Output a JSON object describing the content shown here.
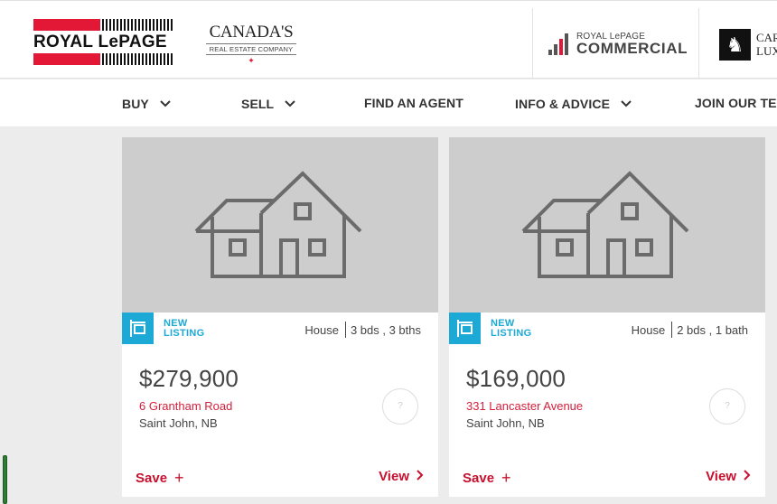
{
  "header": {
    "brand": "ROYAL LePAGE",
    "tagline_main": "CANADA'S",
    "tagline_sub": "REAL ESTATE COMPANY",
    "commercial_top": "ROYAL LePAGE",
    "commercial_main": "COMMERCIAL",
    "luxury_line1": "CAR",
    "luxury_line2": "LUX"
  },
  "nav": {
    "items": [
      {
        "label": "BUY",
        "has_dropdown": true
      },
      {
        "label": "SELL",
        "has_dropdown": true
      },
      {
        "label": "FIND AN AGENT",
        "has_dropdown": false
      },
      {
        "label": "INFO & ADVICE",
        "has_dropdown": true
      },
      {
        "label": "JOIN OUR TEAM",
        "has_dropdown": false
      }
    ]
  },
  "listings": [
    {
      "badge_line1": "NEW",
      "badge_line2": "LISTING",
      "type": "House",
      "rooms": "3 bds , 3 bths",
      "price": "$279,900",
      "address": "6 Grantham Road",
      "city": "Saint John, NB",
      "help": "?",
      "save_label": "Save",
      "view_label": "View"
    },
    {
      "badge_line1": "NEW",
      "badge_line2": "LISTING",
      "type": "House",
      "rooms": "2 bds , 1 bath",
      "price": "$169,000",
      "address": "331 Lancaster Avenue",
      "city": "Saint John, NB",
      "help": "?",
      "save_label": "Save",
      "view_label": "View"
    }
  ],
  "colors": {
    "brand_red": "#e31837",
    "accent_blue": "#1ca9d5",
    "link_red": "#c8102e"
  },
  "icons": [
    "house-placeholder-icon",
    "listing-sign-icon",
    "chevron-down-icon",
    "chevron-right-icon",
    "plus-icon",
    "question-icon",
    "horse-icon"
  ]
}
